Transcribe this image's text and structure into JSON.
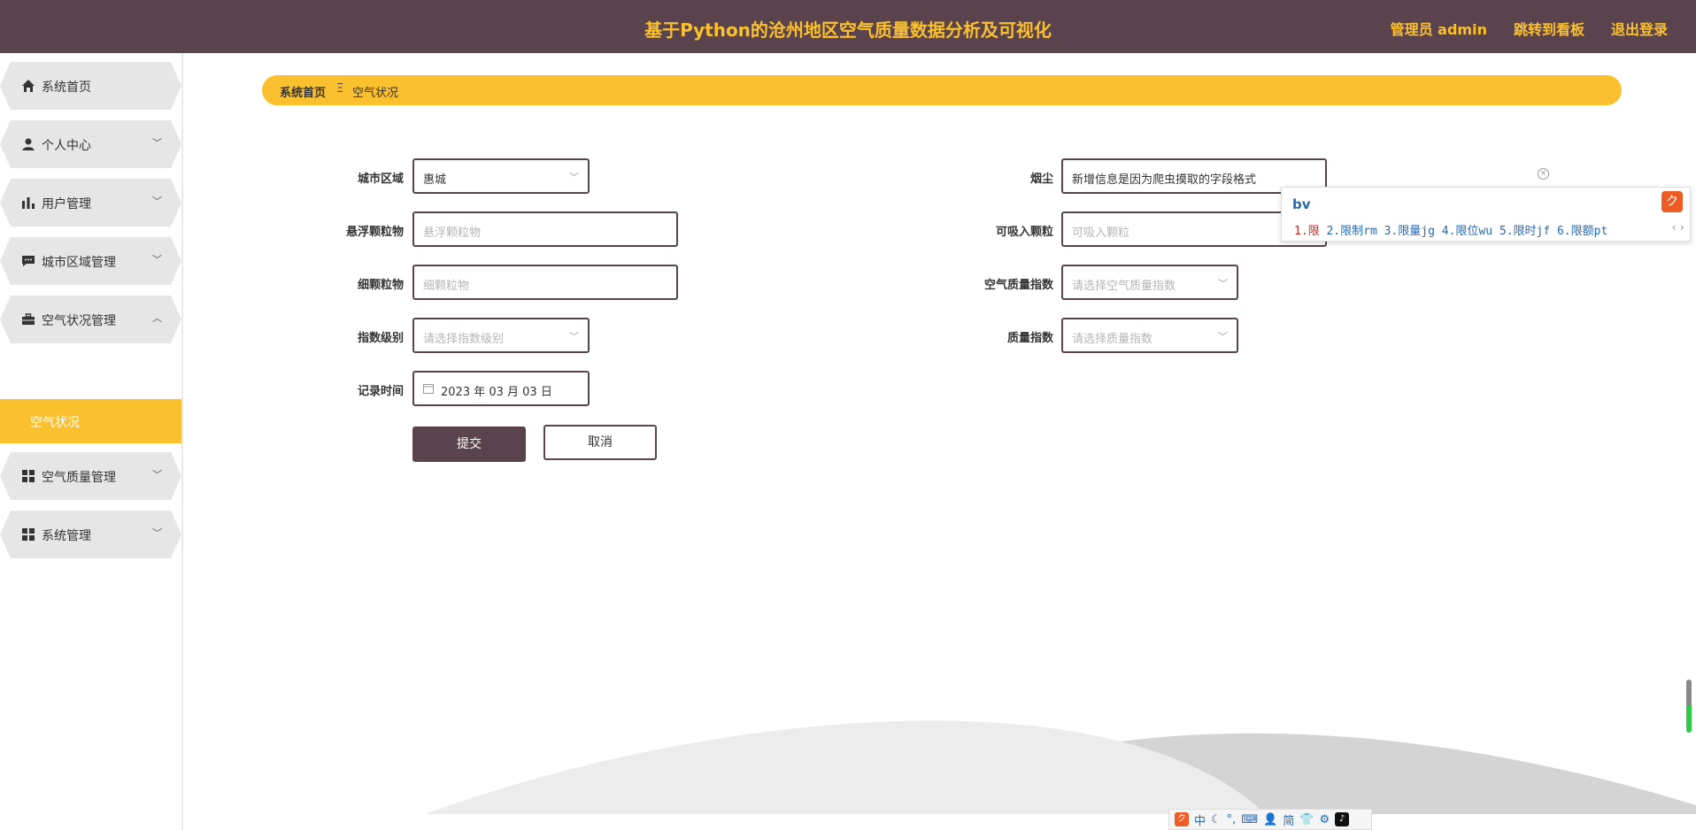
{
  "header": {
    "title": "基于Python的沧州地区空气质量数据分析及可视化",
    "admin": "管理员 admin",
    "dashboard": "跳转到看板",
    "logout": "退出登录"
  },
  "sidebar": {
    "items": [
      {
        "label": "系统首页",
        "icon": "home-icon"
      },
      {
        "label": "个人中心",
        "icon": "user-icon"
      },
      {
        "label": "用户管理",
        "icon": "bar-chart-icon"
      },
      {
        "label": "城市区域管理",
        "icon": "message-icon"
      },
      {
        "label": "空气状况管理",
        "icon": "briefcase-icon"
      },
      {
        "label": "空气质量管理",
        "icon": "grid-icon"
      },
      {
        "label": "系统管理",
        "icon": "grid-icon"
      }
    ],
    "active_sub": "空气状况"
  },
  "breadcrumb": {
    "home": "系统首页",
    "separator": "Ξ",
    "current": "空气状况"
  },
  "form": {
    "city_area": {
      "label": "城市区域",
      "value": "惠城"
    },
    "dust": {
      "label": "烟尘",
      "value": "新增信息是因为爬虫摸取的字段格式"
    },
    "suspended": {
      "label": "悬浮颗粒物",
      "placeholder": "悬浮颗粒物"
    },
    "inhalable": {
      "label": "可吸入颗粒",
      "placeholder": "可吸入颗粒"
    },
    "fine": {
      "label": "细颗粒物",
      "placeholder": "细颗粒物"
    },
    "aqi": {
      "label": "空气质量指数",
      "placeholder": "请选择空气质量指数"
    },
    "index_level": {
      "label": "指数级别",
      "placeholder": "请选择指数级别"
    },
    "quality_index": {
      "label": "质量指数",
      "placeholder": "请选择质量指数"
    },
    "record_time": {
      "label": "记录时间",
      "value": "2023 年 03 月 03 日"
    },
    "submit": "提交",
    "cancel": "取消"
  },
  "ime": {
    "composition": "bv",
    "candidates_first": "1.限",
    "candidates_rest": " 2.限制rm 3.限量jg 4.限位wu 5.限时jf 6.限额pt",
    "toolbar": [
      "中",
      "简"
    ]
  },
  "colors": {
    "brand": "#5a434c",
    "accent": "#fbc02d"
  }
}
